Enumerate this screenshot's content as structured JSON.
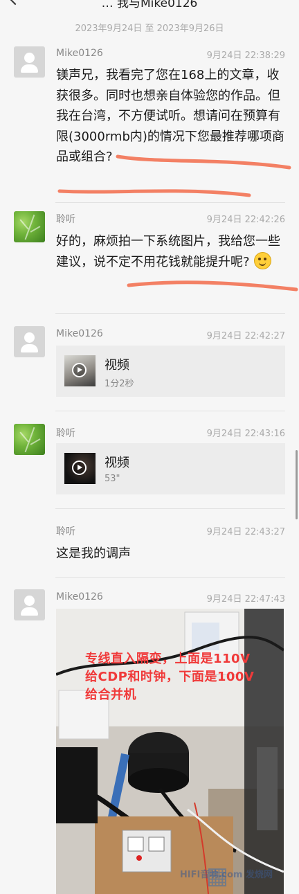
{
  "header": {
    "title": "… 我与Mike0126",
    "daterange": "2023年9月24日 至 2023年9月26日"
  },
  "messages": [
    {
      "sender": "Mike0126",
      "time": "9月24日 22:38:29",
      "text": "镁声兄，我看完了您在168上的文章，收获很多。同时也想亲自体验您的作品。但我在台湾，不方便试听。想请问在预算有限(3000rmb内)的情况下您最推荐哪项商品或组合?"
    },
    {
      "sender": "聆听",
      "time": "9月24日 22:42:26",
      "text": "好的，麻烦拍一下系统图片，我给您一些建议，说不定不用花钱就能提升呢?",
      "emoji": "smile-emoji"
    },
    {
      "sender": "Mike0126",
      "time": "9月24日 22:42:27",
      "video": {
        "label": "视频",
        "duration": "1分2秒"
      }
    },
    {
      "sender": "聆听",
      "time": "9月24日 22:43:16",
      "video": {
        "label": "视频",
        "duration": "53\""
      }
    },
    {
      "sender": "聆听",
      "time": "9月24日 22:43:27",
      "text": "这是我的调声"
    },
    {
      "sender": "Mike0126",
      "time": "9月24日 22:47:43",
      "photo": {
        "caption": "专线直入隔变，上面是110V给CDP和时钟，下面是100V给合并机",
        "watermark": "HIFI音响.com 发烧网"
      }
    }
  ],
  "colors": {
    "annotation": "#f26b4a",
    "caption": "#f03a3a",
    "background": "#f6f6f6"
  }
}
